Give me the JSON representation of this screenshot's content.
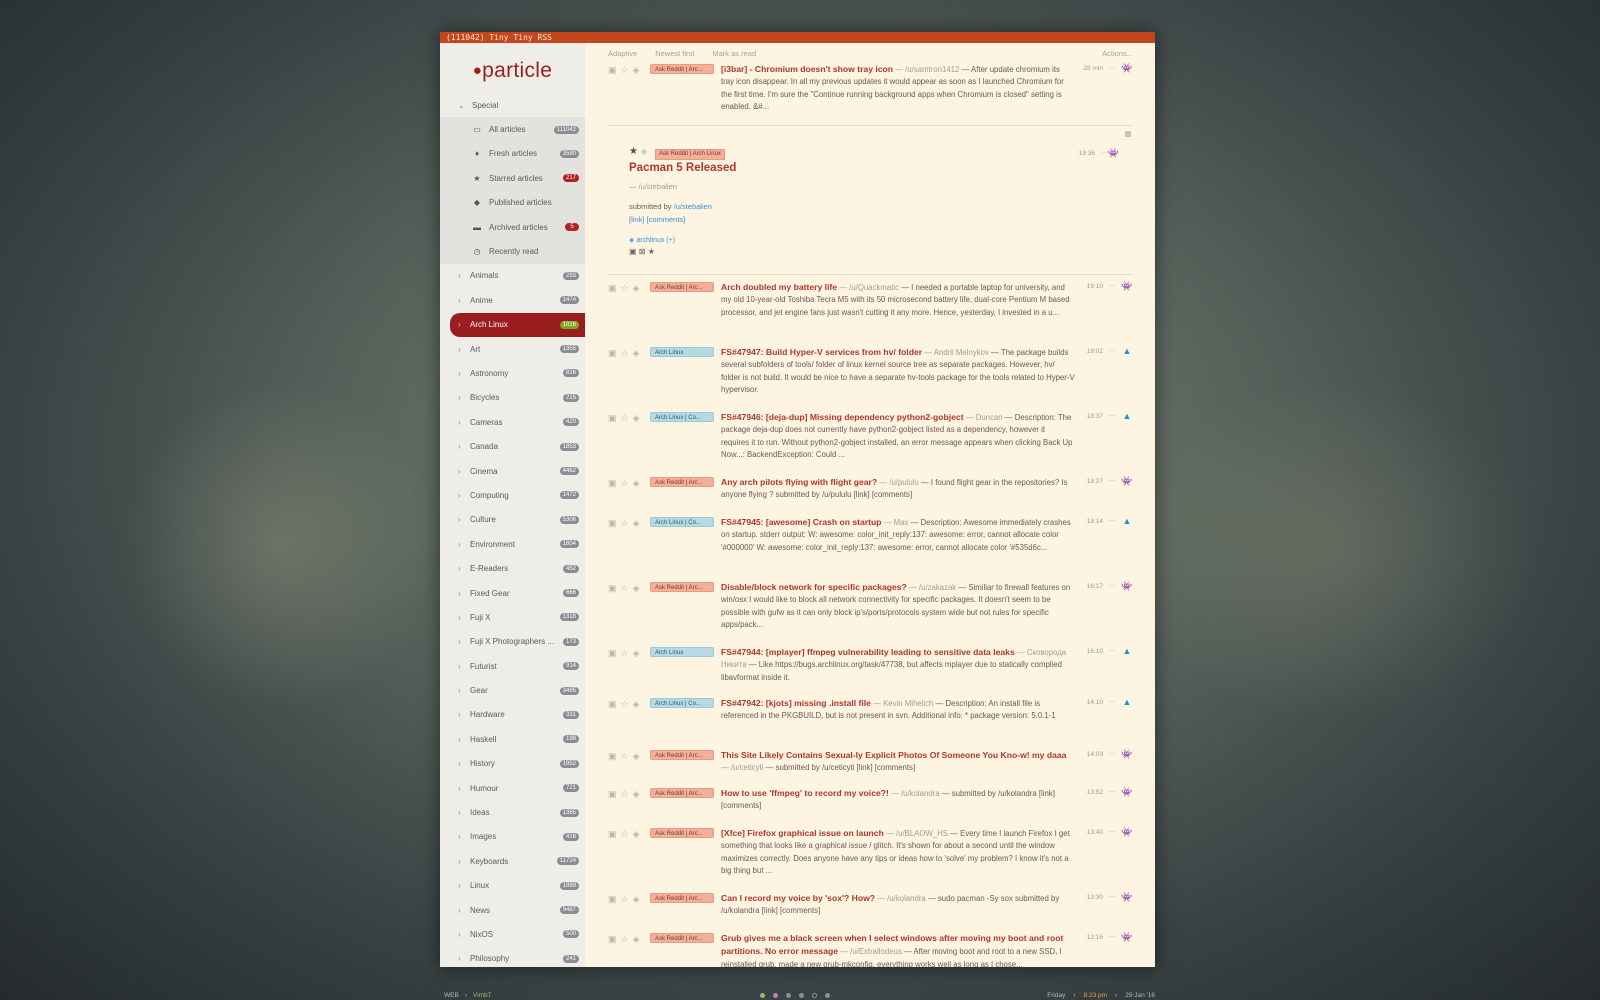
{
  "window": {
    "title": "(111042) Tiny Tiny RSS"
  },
  "sidebar": {
    "logo": "particle",
    "special_label": "Special",
    "special_items": [
      {
        "icon": "inbox-icon",
        "glyph": "▭",
        "label": "All articles",
        "count": "111042",
        "style": "grey"
      },
      {
        "icon": "fire-icon",
        "glyph": "♦",
        "label": "Fresh articles",
        "count": "3590",
        "style": "grey"
      },
      {
        "icon": "star-icon",
        "glyph": "★",
        "label": "Starred articles",
        "count": "217",
        "style": "red"
      },
      {
        "icon": "tag-icon",
        "glyph": "◆",
        "label": "Published articles",
        "count": "",
        "style": "grey"
      },
      {
        "icon": "archive-icon",
        "glyph": "▬",
        "label": "Archived articles",
        "count": "5",
        "style": "red"
      },
      {
        "icon": "clock-icon",
        "glyph": "◷",
        "label": "Recently read",
        "count": "",
        "style": "grey"
      }
    ],
    "categories": [
      {
        "label": "Animals",
        "count": "293"
      },
      {
        "label": "Anime",
        "count": "1474"
      },
      {
        "label": "Arch Linux",
        "count": "1016",
        "active": true
      },
      {
        "label": "Art",
        "count": "1355"
      },
      {
        "label": "Astronomy",
        "count": "816"
      },
      {
        "label": "Bicycles",
        "count": "215"
      },
      {
        "label": "Cameras",
        "count": "420"
      },
      {
        "label": "Canada",
        "count": "1853"
      },
      {
        "label": "Cinema",
        "count": "4462"
      },
      {
        "label": "Computing",
        "count": "1472"
      },
      {
        "label": "Culture",
        "count": "5306"
      },
      {
        "label": "Environment",
        "count": "1804"
      },
      {
        "label": "E-Readers",
        "count": "452"
      },
      {
        "label": "Fixed Gear",
        "count": "666"
      },
      {
        "label": "Fuji X",
        "count": "1318"
      },
      {
        "label": "Fuji X Photographers ...",
        "count": "173"
      },
      {
        "label": "Futurist",
        "count": "914"
      },
      {
        "label": "Gear",
        "count": "3495"
      },
      {
        "label": "Hardware",
        "count": "331"
      },
      {
        "label": "Haskell",
        "count": "198"
      },
      {
        "label": "History",
        "count": "1952"
      },
      {
        "label": "Humour",
        "count": "721"
      },
      {
        "label": "Ideas",
        "count": "1385"
      },
      {
        "label": "Images",
        "count": "416"
      },
      {
        "label": "Keyboards",
        "count": "11724"
      },
      {
        "label": "Linux",
        "count": "1999"
      },
      {
        "label": "News",
        "count": "9487"
      },
      {
        "label": "NixOS",
        "count": "500"
      },
      {
        "label": "Philosophy",
        "count": "241"
      }
    ]
  },
  "toolbar": {
    "view": "Adaptive",
    "sort": "Newest first",
    "mark": "Mark as read",
    "actions": "Actions..."
  },
  "articles_top": [
    {
      "tag": "Ask Reddit | Arc...",
      "tagtype": "reddit",
      "title": "[i3bar] - Chromium doesn't show tray icon",
      "author": "— /u/samtron1412",
      "excerpt": " — After update chromium its tray icon disappear. In all my previous updates it would appear as soon as I launched Chromium for the first time. I'm sure the \"Continue running background apps when Chromium is closed\" setting is enabled. &#...",
      "time": "28 min",
      "fav": "reddit"
    }
  ],
  "expanded": {
    "tag": "Ask Reddit | Arch Linux",
    "time": "19:36",
    "title": "Pacman 5 Released",
    "author": "— /u/stebalien",
    "submitted_by": "submitted by",
    "submitted_user": "/u/stebalien",
    "links": "[link] [comments]",
    "label": "archlinux (+)"
  },
  "articles": [
    {
      "tag": "Ask Reddit | Arc...",
      "tagtype": "reddit",
      "title": "Arch doubled my battery life",
      "author": "— /u/Quackmatic",
      "excerpt": " — I needed a portable laptop for university, and my old 10-year-old Toshiba Tecra M5 with its 50 microsecond battery life, dual-core Pentium M based processor, and jet engine fans just wasn't cutting it any more. Hence, yesterday, I invested in a u...",
      "time": "19:10",
      "fav": "reddit"
    },
    {
      "tag": "Arch Linux",
      "tagtype": "arch",
      "title": "FS#47947: Build Hyper-V services from hv/ folder",
      "author": "— Andrii Melnykov",
      "excerpt": " — The package builds several subfolders of tools/ folder of linux kernel source tree as separate packages. However, hv/ folder is not build. It would be nice to have a separate hv-tools package for the tools related to Hyper-V hypervisor.",
      "time": "19:02",
      "fav": "arch"
    },
    {
      "tag": "Arch Linux | Co...",
      "tagtype": "arch",
      "title": "FS#47946: [deja-dup] Missing dependency python2-gobject",
      "author": "— Duncan",
      "excerpt": " — Description: The package deja-dup does not currently have python2-gobject listed as a dependency, however it requires it to run. Without python2-gobject installed, an error message appears when clicking Back Up Now...: BackendException: Could ...",
      "time": "18:37",
      "fav": "arch"
    },
    {
      "tag": "Ask Reddit | Arc...",
      "tagtype": "reddit",
      "title": "Any arch pilots flying with flight gear?",
      "author": "— /u/pululu",
      "excerpt": " — I found flight gear in the repositories? Is anyone flying ? submitted by /u/pululu [link] [comments]",
      "time": "18:27",
      "fav": "reddit"
    },
    {
      "tag": "Arch Linux | Co...",
      "tagtype": "arch",
      "title": "FS#47945: [awesome] Crash on startup",
      "author": "— Max",
      "excerpt": " — Description: Awesome immediately crashes on startup. stderr output: W: awesome: color_init_reply:137: awesome: error, cannot allocate color '#000000' W: awesome: color_init_reply:137: awesome: error, cannot allocate color '#535d6c...",
      "time": "18:14",
      "fav": "arch"
    },
    {
      "tag": "Ask Reddit | Arc...",
      "tagtype": "reddit",
      "title": "Disable/block network for specific packages?",
      "author": "— /u/zakazak",
      "excerpt": " — Similiar to firewall features on win/osx I would like to block all network connectivity for specific packages. It doesn't seem to be possible with gufw as it can only block ip's/ports/protocols system wide but not rules for specific apps/pack...",
      "time": "16:17",
      "fav": "reddit"
    },
    {
      "tag": "Arch Linux",
      "tagtype": "arch",
      "title": "FS#47944: [mplayer] ffmpeg vulnerability leading to sensitive data leaks",
      "author": "— Сковорода Никита",
      "excerpt": " — Like https://bugs.archlinux.org/task/47738, but affects mplayer due to statically complied libavformat inside it.",
      "time": "16:10",
      "fav": "arch"
    },
    {
      "tag": "Arch Linux | Co...",
      "tagtype": "arch",
      "title": "FS#47942: [kjots] missing .install file",
      "author": "— Kevin Mihelich",
      "excerpt": " — Description: An install file is referenced in the PKGBUILD, but is not present in svn. Additional info: * package version: 5.0.1-1",
      "time": "14:10",
      "fav": "arch"
    },
    {
      "tag": "Ask Reddit | Arc...",
      "tagtype": "reddit",
      "title": "This Site Likely Contains Sexual-ly Explicit Photos Of Someone You Kno-w! my daaa",
      "author": "— /u/ceticyti",
      "excerpt": " — submitted by /u/ceticyti [link] [comments]",
      "time": "14:03",
      "fav": "reddit"
    },
    {
      "tag": "Ask Reddit | Arc...",
      "tagtype": "reddit",
      "title": "How to use 'ffmpeg' to record my voice?!",
      "author": "— /u/kolandra",
      "excerpt": " — submitted by /u/kolandra [link] [comments]",
      "time": "13:52",
      "fav": "reddit"
    },
    {
      "tag": "Ask Reddit | Arc...",
      "tagtype": "reddit",
      "title": "[Xfce] Firefox graphical issue on launch",
      "author": "— /u/BLAOW_HS",
      "excerpt": " — Every time I launch Firefox I get something that looks like a graphical issue / glitch. It's shown for about a second until the window maximizes correctly. Does anyone have any tips or ideas how to 'solve' my problem? I know it's not a big thing but ...",
      "time": "13:40",
      "fav": "reddit"
    },
    {
      "tag": "Ask Reddit | Arc...",
      "tagtype": "reddit",
      "title": "Can I record my voice by 'sox'? How?",
      "author": "— /u/kolandra",
      "excerpt": " — sudo pacman -Sy sox submitted by /u/kolandra [link] [comments]",
      "time": "13:30",
      "fav": "reddit"
    },
    {
      "tag": "Ask Reddit | Arc...",
      "tagtype": "reddit",
      "title": "Grub gives me a black screen when I select windows after moving my boot and root partitions. No error message",
      "author": "— /u/Extrallodeus",
      "excerpt": " — After moving boot and root to a new SSD, I reinstalled grub, made a new grub-mkconfig, everything works well as long as I chose...",
      "time": "12:16",
      "fav": "reddit"
    }
  ],
  "statusbar": {
    "left1": "WEB",
    "left2": "VimbT",
    "day": "Friday",
    "clock": "8:23 pm",
    "date": "29 Jan '16"
  }
}
